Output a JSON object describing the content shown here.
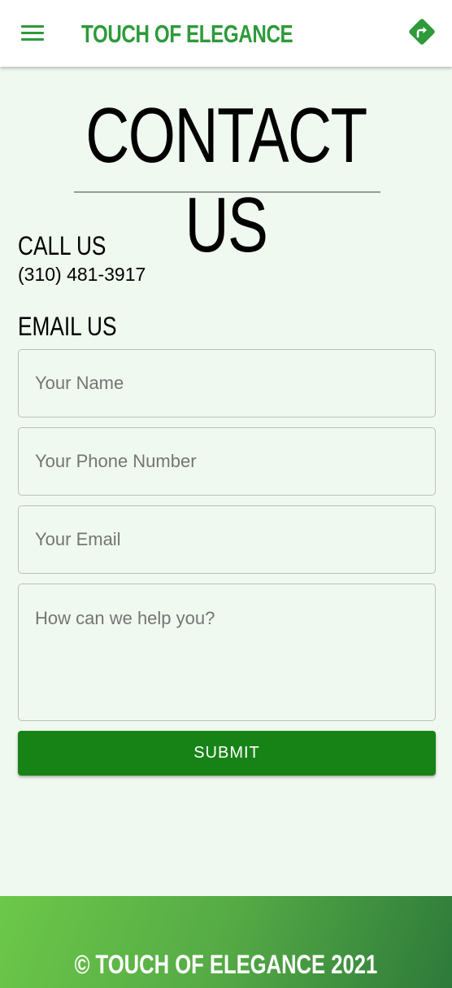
{
  "header": {
    "brand": "TOUCH OF ELEGANCE",
    "menu_icon": "hamburger-menu-icon",
    "directions_icon": "directions-icon",
    "accent_color": "#2e9a3a"
  },
  "page": {
    "title": "CONTACT US"
  },
  "call": {
    "heading": "CALL US",
    "phone": "(310) 481-3917"
  },
  "email": {
    "heading": "EMAIL US"
  },
  "form": {
    "name_placeholder": "Your Name",
    "phone_placeholder": "Your Phone Number",
    "email_placeholder": "Your Email",
    "message_placeholder": "How can we help you?",
    "submit_label": "SUBMIT",
    "submit_color": "#178316"
  },
  "footer": {
    "text": "© TOUCH OF ELEGANCE 2021"
  }
}
